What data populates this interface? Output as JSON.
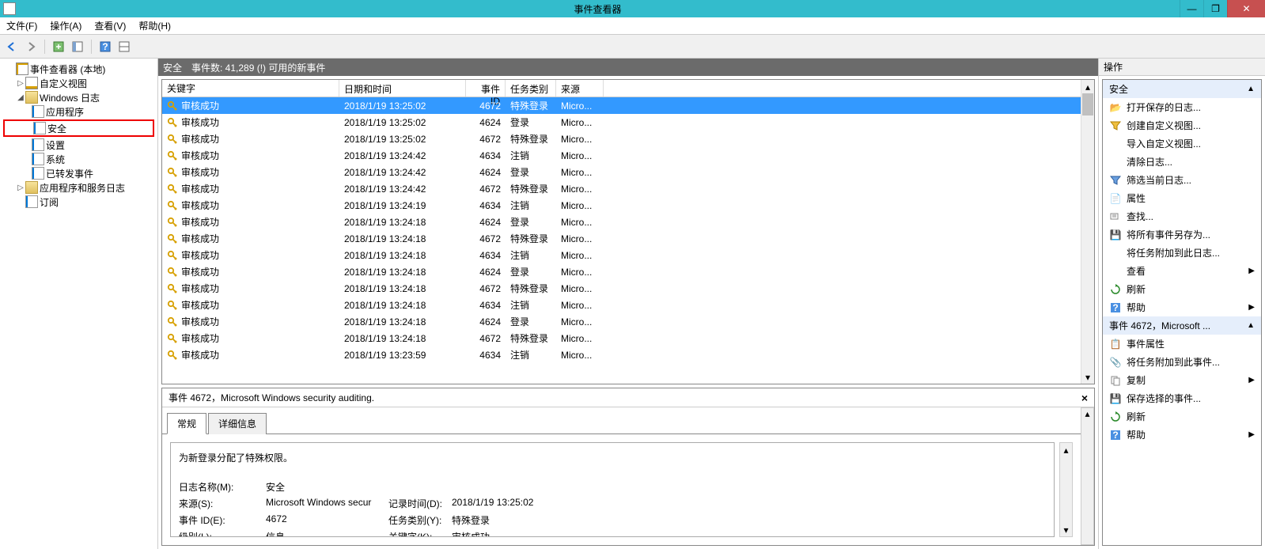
{
  "window": {
    "title": "事件查看器"
  },
  "menu": {
    "file": "文件(F)",
    "action": "操作(A)",
    "view": "查看(V)",
    "help": "帮助(H)"
  },
  "tree": {
    "root": "事件查看器 (本地)",
    "custom_view": "自定义视图",
    "windows_logs": "Windows 日志",
    "application": "应用程序",
    "security": "安全",
    "setup": "设置",
    "system": "系统",
    "forwarded": "已转发事件",
    "app_service": "应用程序和服务日志",
    "subscriptions": "订阅"
  },
  "center": {
    "title": "安全",
    "count_label": "事件数: 41,289 (!) 可用的新事件",
    "columns": {
      "keyword": "关键字",
      "datetime": "日期和时间",
      "event_id": "事件 ID",
      "category": "任务类别",
      "source": "来源"
    },
    "rows": [
      {
        "kw": "审核成功",
        "dt": "2018/1/19 13:25:02",
        "id": "4672",
        "cat": "特殊登录",
        "src": "Micro..."
      },
      {
        "kw": "审核成功",
        "dt": "2018/1/19 13:25:02",
        "id": "4624",
        "cat": "登录",
        "src": "Micro..."
      },
      {
        "kw": "审核成功",
        "dt": "2018/1/19 13:25:02",
        "id": "4672",
        "cat": "特殊登录",
        "src": "Micro..."
      },
      {
        "kw": "审核成功",
        "dt": "2018/1/19 13:24:42",
        "id": "4634",
        "cat": "注销",
        "src": "Micro..."
      },
      {
        "kw": "审核成功",
        "dt": "2018/1/19 13:24:42",
        "id": "4624",
        "cat": "登录",
        "src": "Micro..."
      },
      {
        "kw": "审核成功",
        "dt": "2018/1/19 13:24:42",
        "id": "4672",
        "cat": "特殊登录",
        "src": "Micro..."
      },
      {
        "kw": "审核成功",
        "dt": "2018/1/19 13:24:19",
        "id": "4634",
        "cat": "注销",
        "src": "Micro..."
      },
      {
        "kw": "审核成功",
        "dt": "2018/1/19 13:24:18",
        "id": "4624",
        "cat": "登录",
        "src": "Micro..."
      },
      {
        "kw": "审核成功",
        "dt": "2018/1/19 13:24:18",
        "id": "4672",
        "cat": "特殊登录",
        "src": "Micro..."
      },
      {
        "kw": "审核成功",
        "dt": "2018/1/19 13:24:18",
        "id": "4634",
        "cat": "注销",
        "src": "Micro..."
      },
      {
        "kw": "审核成功",
        "dt": "2018/1/19 13:24:18",
        "id": "4624",
        "cat": "登录",
        "src": "Micro..."
      },
      {
        "kw": "审核成功",
        "dt": "2018/1/19 13:24:18",
        "id": "4672",
        "cat": "特殊登录",
        "src": "Micro..."
      },
      {
        "kw": "审核成功",
        "dt": "2018/1/19 13:24:18",
        "id": "4634",
        "cat": "注销",
        "src": "Micro..."
      },
      {
        "kw": "审核成功",
        "dt": "2018/1/19 13:24:18",
        "id": "4624",
        "cat": "登录",
        "src": "Micro..."
      },
      {
        "kw": "审核成功",
        "dt": "2018/1/19 13:24:18",
        "id": "4672",
        "cat": "特殊登录",
        "src": "Micro..."
      },
      {
        "kw": "审核成功",
        "dt": "2018/1/19 13:23:59",
        "id": "4634",
        "cat": "注销",
        "src": "Micro..."
      }
    ],
    "detail": {
      "header": "事件 4672，Microsoft Windows security auditing.",
      "tab_general": "常规",
      "tab_details": "详细信息",
      "message": "为新登录分配了特殊权限。",
      "log_name_label": "日志名称(M):",
      "log_name_value": "安全",
      "source_label": "来源(S):",
      "source_value": "Microsoft Windows secur",
      "logged_label": "记录时间(D):",
      "logged_value": "2018/1/19 13:25:02",
      "event_id_label": "事件 ID(E):",
      "event_id_value": "4672",
      "category_label": "任务类别(Y):",
      "category_value": "特殊登录",
      "level_label": "级别(L):",
      "level_value": "信息",
      "kw_label": "关键字(K):",
      "kw_value": "审核成功"
    }
  },
  "actions": {
    "header": "操作",
    "section1": "安全",
    "open_saved": "打开保存的日志...",
    "create_view": "创建自定义视图...",
    "import_view": "导入自定义视图...",
    "clear_log": "清除日志...",
    "filter_log": "筛选当前日志...",
    "properties": "属性",
    "find": "查找...",
    "save_all": "将所有事件另存为...",
    "attach_task": "将任务附加到此日志...",
    "view": "查看",
    "refresh": "刷新",
    "help": "帮助",
    "section2": "事件 4672，Microsoft ...",
    "event_props": "事件属性",
    "attach_task_event": "将任务附加到此事件...",
    "copy": "复制",
    "save_selected": "保存选择的事件...",
    "refresh2": "刷新",
    "help2": "帮助"
  }
}
